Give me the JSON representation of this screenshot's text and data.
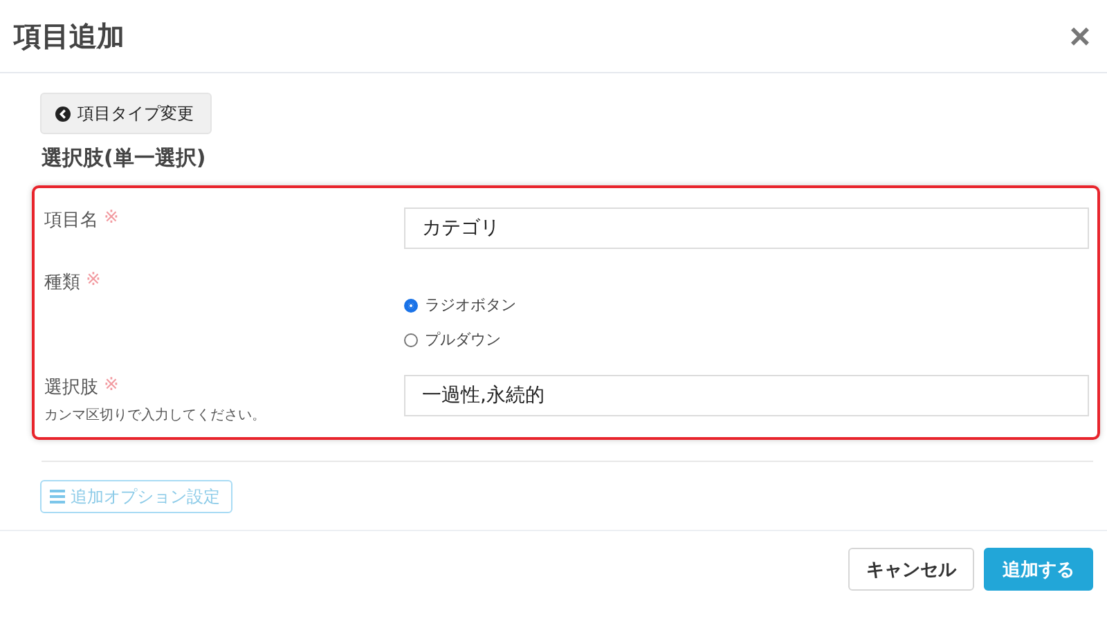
{
  "dialog": {
    "title": "項目追加",
    "close": "×"
  },
  "type_change_button": "項目タイプ変更",
  "section_title": "選択肢(単一選択)",
  "fields": [
    {
      "kind": "text",
      "label": "項目名",
      "required_mark": "※",
      "value": "カテゴリ"
    },
    {
      "kind": "radio",
      "label": "種類",
      "required_mark": "※",
      "options": [
        {
          "label": "ラジオボタン",
          "selected": true
        },
        {
          "label": "プルダウン",
          "selected": false
        }
      ]
    },
    {
      "kind": "text",
      "label": "選択肢",
      "required_mark": "※",
      "hint": "カンマ区切りで入力してください。",
      "value": "一過性,永続的"
    }
  ],
  "options_button": "追加オプション設定",
  "buttons": [
    {
      "kind": "default",
      "label": "キャンセル"
    },
    {
      "kind": "primary",
      "label": "追加する"
    }
  ]
}
